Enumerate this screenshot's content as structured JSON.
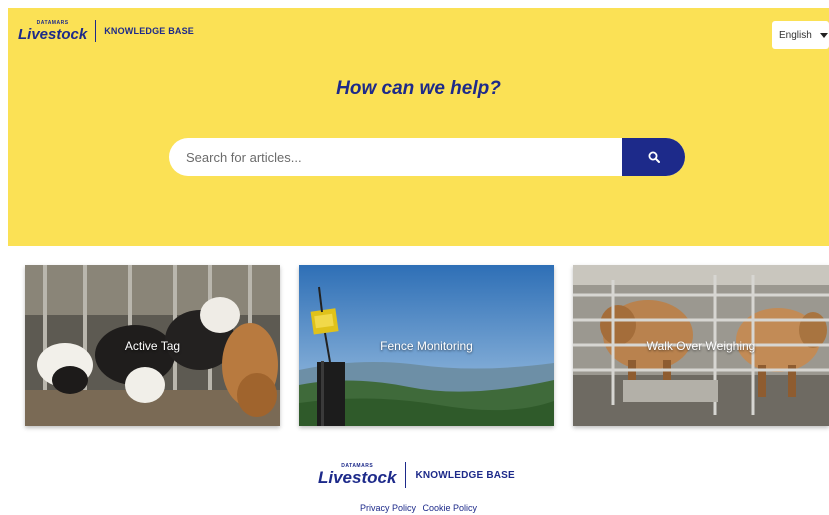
{
  "header": {
    "brand_top": "DATAMARS",
    "brand_main": "Livestock",
    "kb_label": "KNOWLEDGE BASE",
    "language": "English"
  },
  "hero": {
    "title": "How can we help?"
  },
  "search": {
    "placeholder": "Search for articles..."
  },
  "cards": [
    {
      "label": "Active Tag"
    },
    {
      "label": "Fence Monitoring"
    },
    {
      "label": "Walk Over Weighing"
    }
  ],
  "footer": {
    "brand_top": "DATAMARS",
    "brand_main": "Livestock",
    "kb_label": "KNOWLEDGE BASE",
    "links": [
      "Privacy Policy",
      "Cookie Policy"
    ]
  },
  "colors": {
    "hero_bg": "#fbe155",
    "brand_blue": "#1d2a8a"
  }
}
